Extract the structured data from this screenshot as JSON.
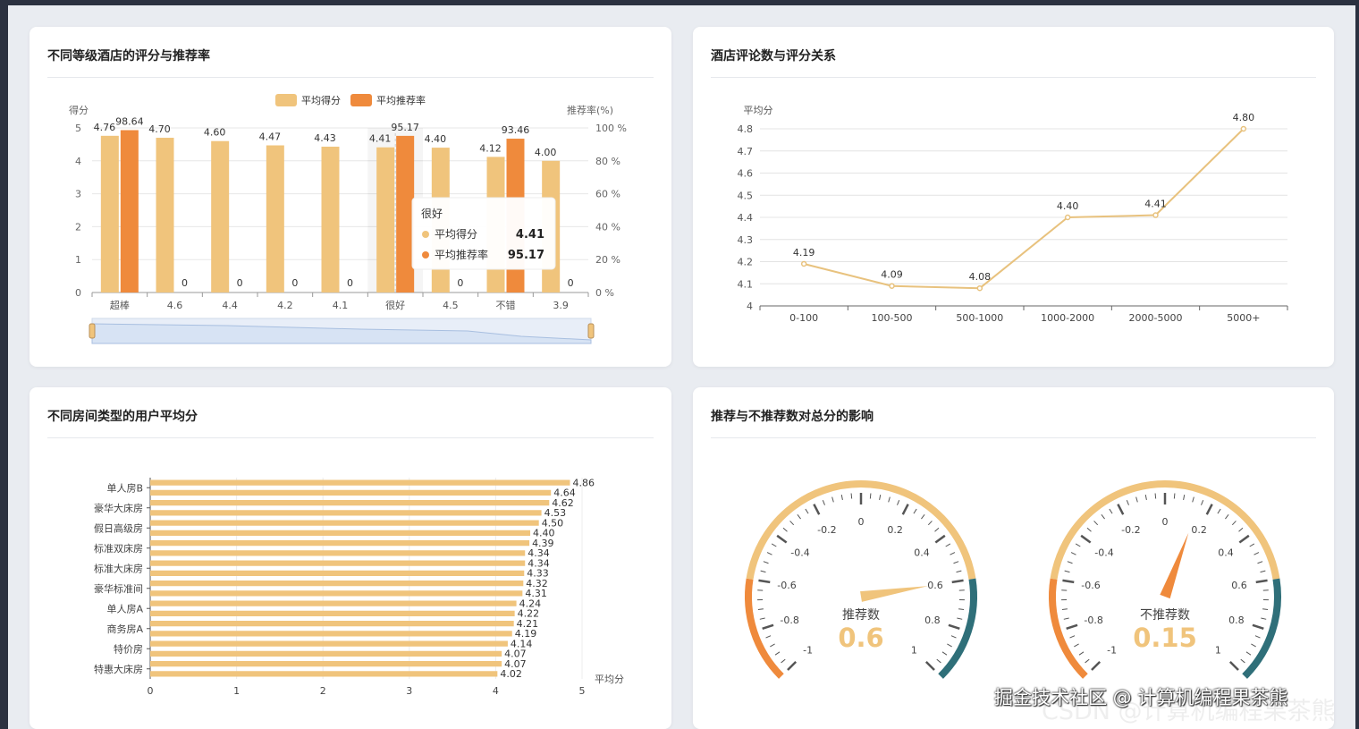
{
  "cards": {
    "c1_title": "不同等级酒店的评分与推荐率",
    "c2_title": "酒店评论数与评分关系",
    "c3_title": "不同房间类型的用户平均分",
    "c4_title": "推荐与不推荐数对总分的影响"
  },
  "watermark": {
    "main": "掘金技术社区 @ 计算机编程果茶熊",
    "ghost": "CSDN @计算机编程果茶熊"
  },
  "colors": {
    "score": "#f0c47c",
    "rate": "#ef8a3c",
    "line": "#e8c27e",
    "tooltip_rate": "#ef8a3c",
    "gauge_dark": "#2f6f79"
  },
  "chart_data": [
    {
      "type": "bar",
      "title": "不同等级酒店的评分与推荐率",
      "categories": [
        "超棒",
        "4.6",
        "4.4",
        "4.2",
        "4.1",
        "很好",
        "4.5",
        "不错",
        "3.9"
      ],
      "series": [
        {
          "name": "平均得分",
          "axis": "left",
          "values": [
            4.76,
            4.7,
            4.6,
            4.47,
            4.43,
            4.41,
            4.4,
            4.12,
            4.0
          ]
        },
        {
          "name": "平均推荐率",
          "axis": "right",
          "values": [
            98.64,
            0,
            0,
            0,
            0,
            95.17,
            0,
            93.46,
            0
          ]
        }
      ],
      "ylabel_left": "得分",
      "ylabel_right": "推荐率(%)",
      "ylim_left": [
        0,
        5
      ],
      "ylim_right": [
        0,
        100
      ],
      "yticks_left": [
        "0",
        "1",
        "2",
        "3",
        "4",
        "5"
      ],
      "yticks_right": [
        "0 %",
        "20 %",
        "40 %",
        "60 %",
        "80 %",
        "100 %"
      ],
      "legend": "top-center",
      "grid": true,
      "datazoom": true,
      "tooltip": {
        "title": "很好",
        "rows": [
          {
            "name": "平均得分",
            "value": "4.41"
          },
          {
            "name": "平均推荐率",
            "value": "95.17"
          }
        ]
      }
    },
    {
      "type": "line",
      "title": "酒店评论数与评分关系",
      "categories": [
        "0-100",
        "100-500",
        "500-1000",
        "1000-2000",
        "2000-5000",
        "5000+"
      ],
      "series": [
        {
          "values": [
            4.19,
            4.09,
            4.08,
            4.4,
            4.41,
            4.8
          ]
        }
      ],
      "ylabel": "平均分",
      "ylim": [
        4,
        4.8
      ],
      "yticks": [
        "4",
        "4.1",
        "4.2",
        "4.3",
        "4.4",
        "4.5",
        "4.6",
        "4.7",
        "4.8"
      ],
      "grid": true
    },
    {
      "type": "bar",
      "orientation": "horizontal",
      "title": "不同房间类型的用户平均分",
      "ytick_labels": [
        "单人房B",
        "豪华大床房",
        "假日高级房",
        "标准双床房",
        "标准大床房",
        "豪华标准间",
        "单人房A",
        "商务房A",
        "特价房",
        "特惠大床房"
      ],
      "values": [
        4.86,
        4.64,
        4.62,
        4.53,
        4.5,
        4.4,
        4.39,
        4.34,
        4.34,
        4.33,
        4.32,
        4.31,
        4.24,
        4.22,
        4.21,
        4.19,
        4.14,
        4.07,
        4.07,
        4.02
      ],
      "xlabel": "平均分",
      "xlim": [
        0,
        5
      ],
      "xticks": [
        "0",
        "1",
        "2",
        "3",
        "4",
        "5"
      ]
    },
    {
      "type": "gauge",
      "title": "推荐与不推荐数对总分的影响",
      "gauges": [
        {
          "name": "推荐数",
          "value": 0.6,
          "display": "0.6"
        },
        {
          "name": "不推荐数",
          "value": 0.15,
          "display": "0.15"
        }
      ],
      "min": -1,
      "max": 1,
      "tick_labels": [
        "-1",
        "-0.8",
        "-0.6",
        "-0.4",
        "-0.2",
        "0",
        "0.2",
        "0.4",
        "0.6",
        "0.8",
        "1"
      ]
    }
  ]
}
